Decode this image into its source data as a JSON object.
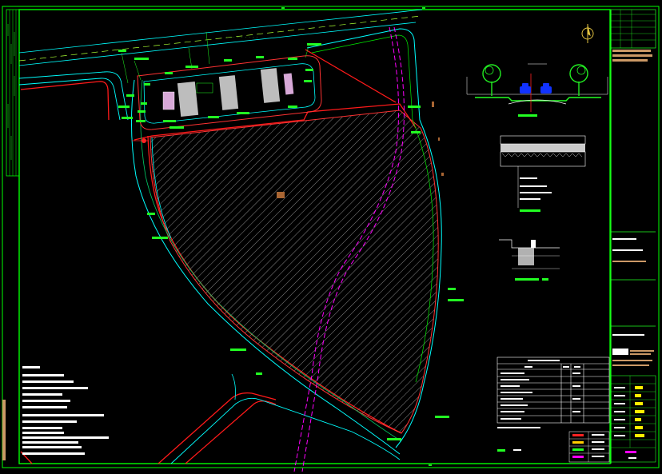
{
  "drawing": {
    "colors": {
      "background": "#000000",
      "frame": "#00ff00",
      "road_edge": "#00ffff",
      "property_line": "#ff0000",
      "pipeline": "#ff00ff",
      "text": "#00ff00",
      "hatch": "#bfbfbf",
      "highlight": "#ffff00",
      "tree": "#22ee22",
      "car": "#1133ff"
    },
    "icons": [
      "north-arrow-icon",
      "tree-icon",
      "car-icon"
    ],
    "legend_rows": 9,
    "title_block_rows": 10
  }
}
